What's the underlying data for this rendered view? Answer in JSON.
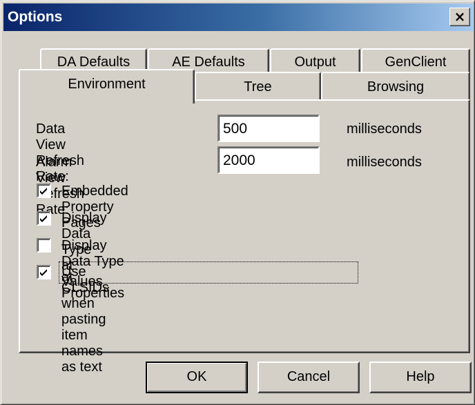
{
  "window": {
    "title": "Options",
    "close_glyph": "×"
  },
  "tabs_back": [
    {
      "label": "DA Defaults"
    },
    {
      "label": "AE Defaults"
    },
    {
      "label": "Output"
    },
    {
      "label": "GenClient"
    }
  ],
  "tabs_front": [
    {
      "label": "Environment",
      "active": true
    },
    {
      "label": "Tree"
    },
    {
      "label": "Browsing"
    }
  ],
  "environment": {
    "data_view": {
      "label": "Data View Refresh Rate:",
      "value": "500",
      "unit": "milliseconds"
    },
    "alarm_view": {
      "label": "Alarm View Refresh Rate:",
      "value": "2000",
      "unit": "milliseconds"
    },
    "options": [
      {
        "label": "Embedded Property Pages",
        "checked": true
      },
      {
        "label": "Display Data Type at Values",
        "checked": true
      },
      {
        "label": "Display Data Type at Properties",
        "checked": false
      },
      {
        "label": "Use CLSIDs when pasting item names as text",
        "checked": true
      }
    ]
  },
  "buttons": {
    "ok": "OK",
    "cancel": "Cancel",
    "help": "Help"
  },
  "colors": {
    "face": "#d4d0c8",
    "title_start": "#0a246a",
    "title_end": "#a6caf0"
  }
}
